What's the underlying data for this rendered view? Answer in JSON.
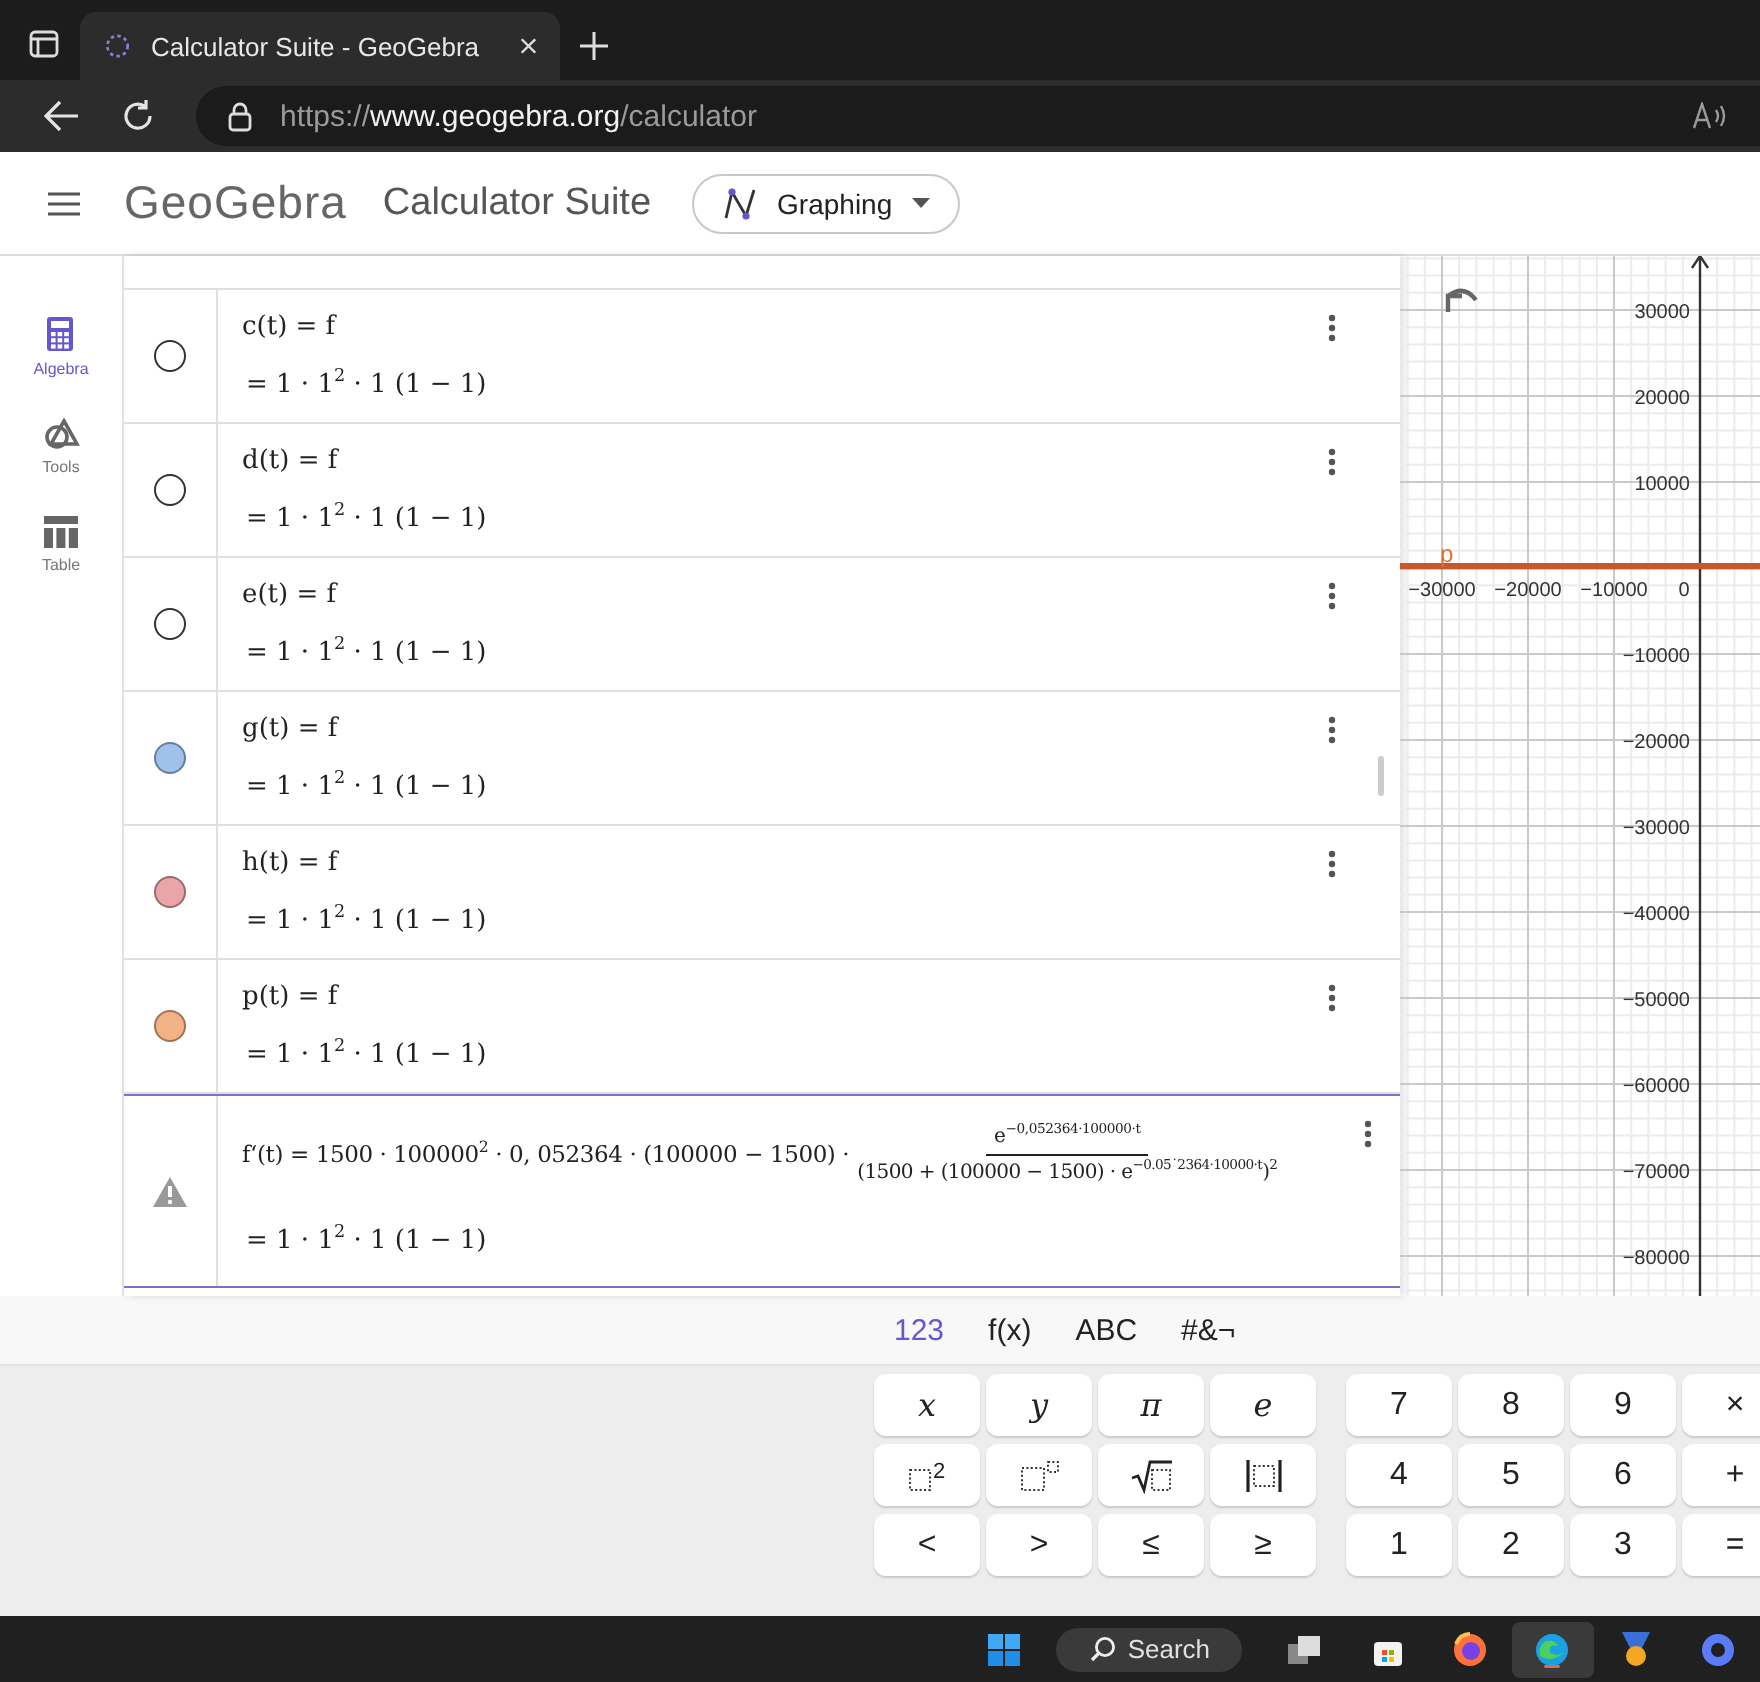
{
  "browser": {
    "tab_title": "Calculator Suite - GeoGebra",
    "url_scheme": "https://",
    "url_host": "www.geogebra.org",
    "url_path": "/calculator"
  },
  "header": {
    "logo": "GeoGebra",
    "title": "Calculator Suite",
    "app_menu": "Graphing"
  },
  "rail": [
    {
      "label": "Algebra",
      "kind": "calculator",
      "selected": true
    },
    {
      "label": "Tools",
      "kind": "shapes",
      "selected": false
    },
    {
      "label": "Table",
      "kind": "table",
      "selected": false
    }
  ],
  "algebra": [
    {
      "kind": "function",
      "definition": "c(t) = f",
      "output": "= 1 · 1$^{2}$ · 1 (1 − 1)",
      "shown": false
    },
    {
      "kind": "function",
      "definition": "d(t) = f",
      "output": "= 1 · 1$^{2}$ · 1 (1 − 1)",
      "shown": false
    },
    {
      "kind": "function",
      "definition": "e(t) = f",
      "output": "= 1 · 1$^{2}$ · 1 (1 − 1)",
      "shown": false
    },
    {
      "kind": "function",
      "definition": "g(t) = f",
      "output": "= 1 · 1$^{2}$ · 1 (1 − 1)",
      "shown": true,
      "color": "#9fc2ea"
    },
    {
      "kind": "function",
      "definition": "h(t) = f",
      "output": "= 1 · 1$^{2}$ · 1 (1 − 1)",
      "shown": true,
      "color": "#eba5a9"
    },
    {
      "kind": "function",
      "definition": "p(t) = f",
      "output": "= 1 · 1$^{2}$ · 1 (1 − 1)",
      "shown": true,
      "color": "#f3b286"
    },
    {
      "kind": "warning",
      "lead": "f‘(t) = 1500 · 100000$^{2}$ · 0, 052364 · (100000 − 1500) ·",
      "numerator": "e$^{−0,052364·100000·t}$",
      "denominator": "(1500 + (100000 − 1500) · e$^{−0.05˙2364·10000·t}$)$^{2}$",
      "output": "= 1 · 1$^{2}$ · 1 (1 − 1)",
      "selected": true
    }
  ],
  "graph": {
    "x_labels": [
      "−30000",
      "−20000",
      "−10000",
      "0"
    ],
    "y_labels": [
      "30000",
      "20000",
      "10000",
      "−10000",
      "−20000",
      "−30000",
      "−40000",
      "−50000",
      "−60000",
      "−70000",
      "−80000"
    ],
    "curve_label": "p"
  },
  "keyboard": {
    "tabs": [
      {
        "label": "123",
        "selected": true
      },
      {
        "label": "f(x)",
        "selected": false
      },
      {
        "label": "ABC",
        "selected": false
      },
      {
        "label": "#&¬",
        "selected": false
      }
    ],
    "left_keys": [
      {
        "kind": "italic",
        "label": "x"
      },
      {
        "kind": "italic",
        "label": "y"
      },
      {
        "kind": "italic",
        "label": "π"
      },
      {
        "kind": "italic",
        "label": "e"
      },
      {
        "kind": "squared",
        "label": "2"
      },
      {
        "kind": "power"
      },
      {
        "kind": "sqrt"
      },
      {
        "kind": "abs"
      },
      {
        "kind": "text",
        "label": "<"
      },
      {
        "kind": "text",
        "label": ">"
      },
      {
        "kind": "text",
        "label": "≤"
      },
      {
        "kind": "text",
        "label": "≥"
      }
    ],
    "right_keys": [
      "7",
      "8",
      "9",
      "×",
      "4",
      "5",
      "6",
      "+",
      "1",
      "2",
      "3",
      "="
    ]
  },
  "taskbar": {
    "search": "Search"
  }
}
